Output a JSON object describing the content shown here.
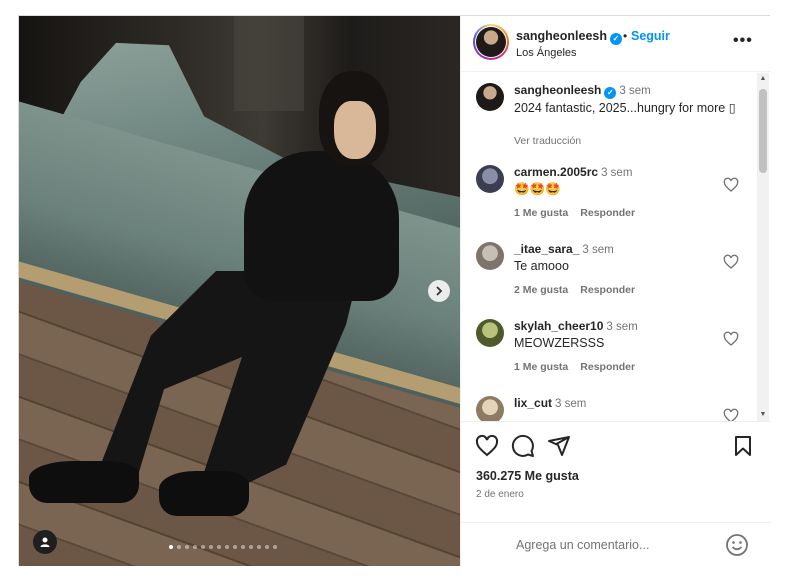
{
  "post": {
    "image_alt": "Man sitting on a green leather sofa",
    "carousel": {
      "total": 14,
      "active": 0
    },
    "next_icon": "chevron-right-icon",
    "tag_icon": "person-tag-icon"
  },
  "header": {
    "username": "sangheonleesh",
    "verified_icon": "verified-badge-icon",
    "dot": "•",
    "follow_label": "Seguir",
    "location": "Los Ángeles",
    "more_label": "•••"
  },
  "caption": {
    "username": "sangheonleesh",
    "time": "3 sem",
    "text": "2024 fantastic, 2025...hungry for more ▯",
    "translate_label": "Ver traducción"
  },
  "comments": [
    {
      "username": "carmen.2005rc",
      "time": "3 sem",
      "text": "🤩🤩🤩",
      "likes": "1 Me gusta",
      "reply": "Responder"
    },
    {
      "username": "_itae_sara_",
      "time": "3 sem",
      "text": "Te amooo",
      "likes": "2 Me gusta",
      "reply": "Responder"
    },
    {
      "username": "skylah_cheer10",
      "time": "3 sem",
      "text": "MEOWZERSSS",
      "likes": "1 Me gusta",
      "reply": "Responder"
    },
    {
      "username": "lix_cut",
      "time": "3 sem",
      "text": "",
      "likes": "",
      "reply": ""
    }
  ],
  "actions": {
    "like_icon": "heart-icon",
    "comment_icon": "comment-icon",
    "share_icon": "share-icon",
    "save_icon": "bookmark-icon",
    "likes_count": "360.275 Me gusta",
    "date": "2 de enero"
  },
  "composer": {
    "placeholder": "Agrega un comentario...",
    "emoji_icon": "emoji-icon"
  },
  "colors": {
    "accent": "#0095f6",
    "text": "#262626",
    "muted": "#737373",
    "border": "#dbdbdb"
  }
}
